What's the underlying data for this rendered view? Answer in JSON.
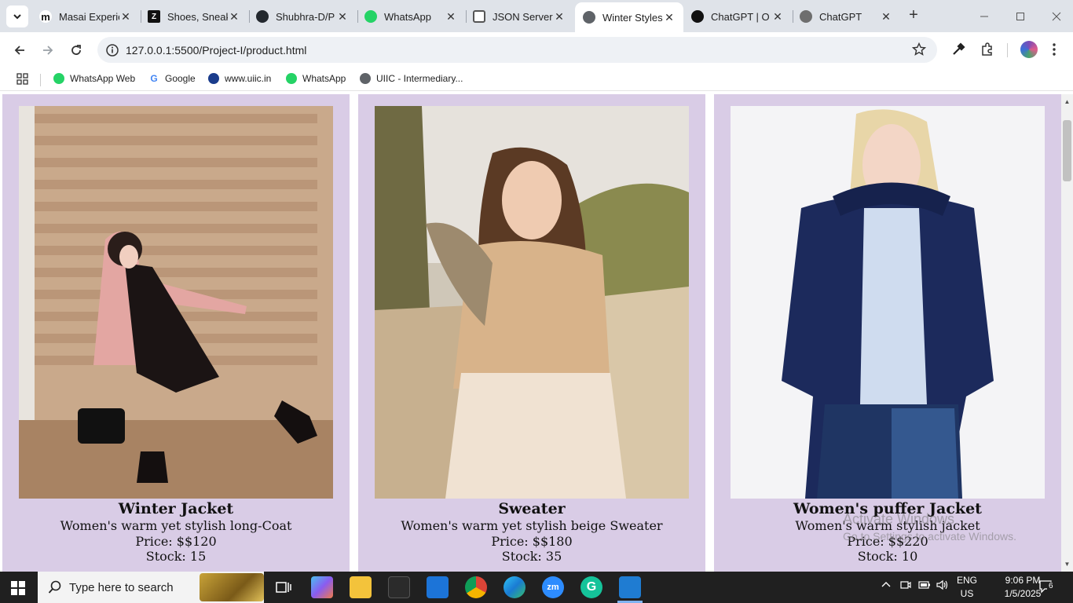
{
  "browser": {
    "tabs": [
      {
        "label": "Masai Experie",
        "favicon_color": "#6b4fd8",
        "favicon_letter": "m"
      },
      {
        "label": "Shoes, Sneak",
        "favicon_color": "#111111",
        "favicon_letter": "Z"
      },
      {
        "label": "Shubhra-D/P",
        "favicon_color": "#24292f",
        "favicon_letter": ""
      },
      {
        "label": "WhatsApp",
        "favicon_color": "#25d366",
        "favicon_letter": ""
      },
      {
        "label": "JSON Server",
        "favicon_color": "#555555",
        "favicon_letter": ""
      },
      {
        "label": "Winter Styles",
        "favicon_color": "#5f6368",
        "favicon_letter": "",
        "active": true
      },
      {
        "label": "ChatGPT | O",
        "favicon_color": "#111111",
        "favicon_letter": ""
      },
      {
        "label": "ChatGPT",
        "favicon_color": "#6e6e6e",
        "favicon_letter": ""
      }
    ],
    "url": "127.0.0.1:5500/Project-I/product.html",
    "bookmarks": [
      {
        "label": "WhatsApp Web",
        "color": "#25d366"
      },
      {
        "label": "Google",
        "color": "#4285f4"
      },
      {
        "label": "www.uiic.in",
        "color": "#1a3c8c"
      },
      {
        "label": "WhatsApp",
        "color": "#25d366"
      },
      {
        "label": "UIIC - Intermediary...",
        "color": "#5f6368"
      }
    ]
  },
  "products": [
    {
      "title": "Winter Jacket",
      "description": "Women's warm yet stylish long-Coat",
      "price": "Price: $$120",
      "stock": "Stock: 15"
    },
    {
      "title": "Sweater",
      "description": "Women's warm yet stylish beige Sweater",
      "price": "Price: $$180",
      "stock": "Stock: 35"
    },
    {
      "title": "Women's puffer Jacket",
      "description": "Women's warm stylish jacket",
      "price": "Price: $$220",
      "stock": "Stock: 10"
    }
  ],
  "watermark": {
    "title": "Activate Windows",
    "subtitle": "Go to Settings to activate Windows."
  },
  "taskbar": {
    "search_placeholder": "Type here to search",
    "language": "ENG",
    "region": "US",
    "time": "9:06 PM",
    "date": "1/5/2025",
    "notification_count": "6"
  },
  "colors": {
    "card_background": "#d9cce6",
    "tabstrip": "#dfe3e9",
    "taskbar": "#202020"
  }
}
